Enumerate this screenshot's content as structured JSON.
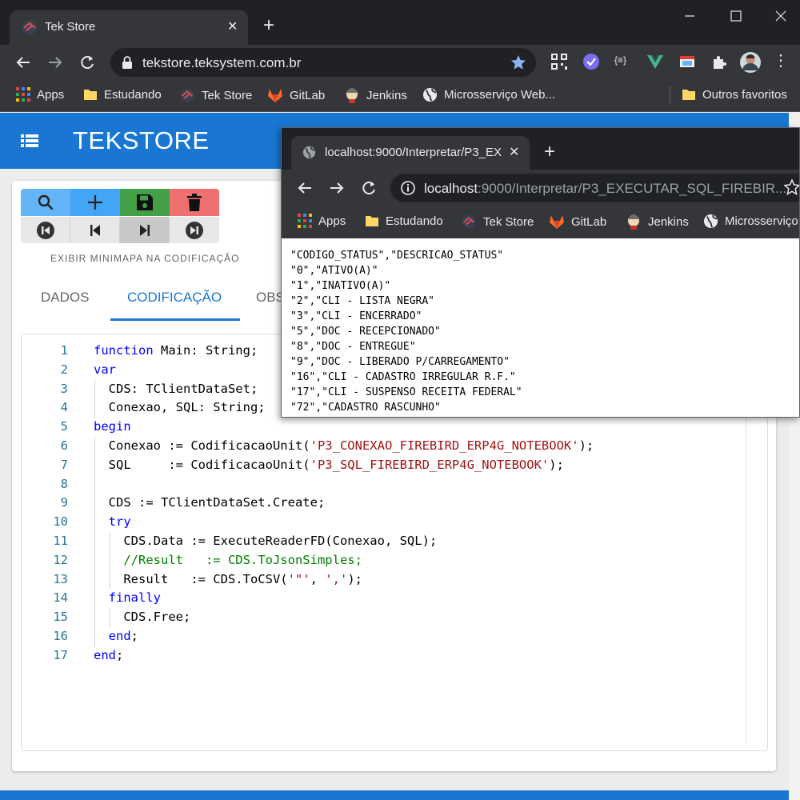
{
  "browser": {
    "tab_title": "Tek Store",
    "url": "tekstore.teksystem.com.br",
    "bookmarks": [
      "Apps",
      "Estudando",
      "Tek Store",
      "GitLab",
      "Jenkins",
      "Microsserviço Web..."
    ],
    "other_bookmarks": "Outros favoritos"
  },
  "app": {
    "title": "TEKSTORE",
    "minimap_label": "EXIBIR MINIMAPA NA CODIFICAÇÃO",
    "tabs": [
      "DADOS",
      "CODIFICAÇÃO",
      "OBS"
    ],
    "active_tab": "CODIFICAÇÃO",
    "toolbar_buttons": [
      "search-button",
      "add-button",
      "save-button",
      "delete-button"
    ],
    "nav_buttons": [
      "first-record-button",
      "previous-record-button",
      "next-record-button",
      "last-record-button"
    ],
    "colors": {
      "primary": "#1976d2",
      "search": "#64b5f6",
      "add": "#42a5f5",
      "save": "#43a047",
      "delete": "#ef7070"
    }
  },
  "code": {
    "line_numbers": [
      "1",
      "2",
      "3",
      "4",
      "5",
      "6",
      "7",
      "8",
      "9",
      "10",
      "11",
      "12",
      "13",
      "14",
      "15",
      "16",
      "17"
    ]
  },
  "popup": {
    "tab_title": "localhost:9000/Interpretar/P3_EX",
    "url_host": "localhost",
    "url_rest": ":9000/Interpretar/P3_EXECUTAR_SQL_FIREBIR...",
    "bookmarks": [
      "Apps",
      "Estudando",
      "Tek Store",
      "GitLab",
      "Jenkins",
      "Microsserviço"
    ],
    "csv_lines": [
      "\"CODIGO_STATUS\",\"DESCRICAO_STATUS\"",
      "\"0\",\"ATIVO(A)\"",
      "\"1\",\"INATIVO(A)\"",
      "\"2\",\"CLI - LISTA NEGRA\"",
      "\"3\",\"CLI - ENCERRADO\"",
      "\"5\",\"DOC - RECEPCIONADO\"",
      "\"8\",\"DOC - ENTREGUE\"",
      "\"9\",\"DOC - LIBERADO P/CARREGAMENTO\"",
      "\"16\",\"CLI - CADASTRO IRREGULAR R.F.\"",
      "\"17\",\"CLI - SUSPENSO RECEITA FEDERAL\"",
      "\"72\",\"CADASTRO RASCUNHO\""
    ]
  }
}
